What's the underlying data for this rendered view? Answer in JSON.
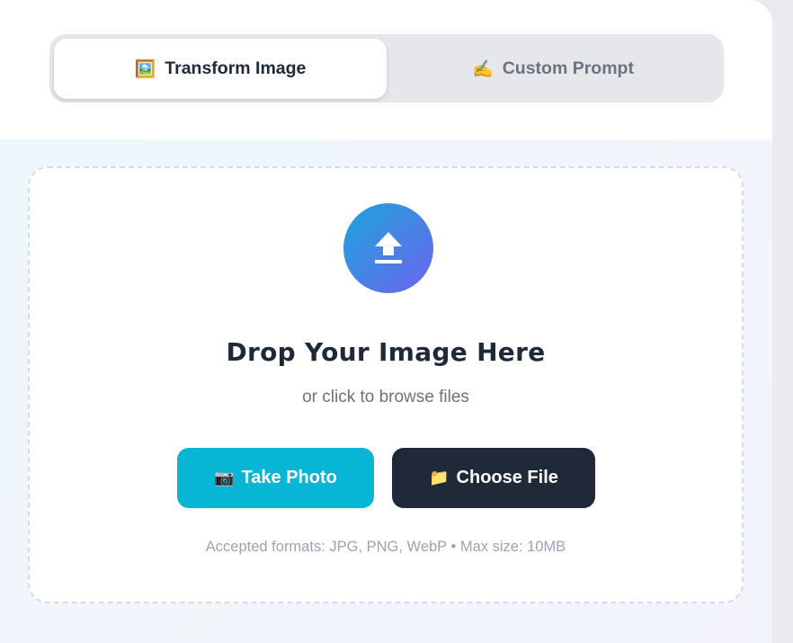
{
  "tabs": {
    "transform": {
      "icon": "🖼️",
      "label": "Transform Image"
    },
    "custom": {
      "icon": "✍️",
      "label": "Custom Prompt"
    }
  },
  "dropzone": {
    "icon": "upload-icon",
    "title": "Drop Your Image Here",
    "subtitle": "or click to browse files",
    "take_photo": {
      "icon": "📷",
      "label": "Take Photo"
    },
    "choose_file": {
      "icon": "📁",
      "label": "Choose File"
    },
    "note": "Accepted formats: JPG, PNG, WebP • Max size: 10MB"
  },
  "colors": {
    "accent_gradient_start": "#1ca5dc",
    "accent_gradient_end": "#6e64ee",
    "take_photo_bg": "#06b6d4",
    "choose_file_bg": "#1f2937"
  }
}
